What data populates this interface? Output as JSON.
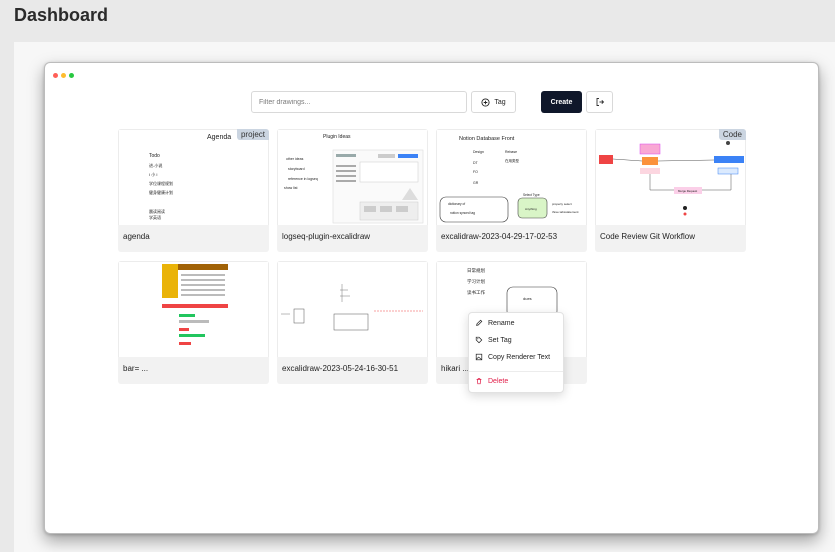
{
  "page": {
    "title": "Dashboard"
  },
  "toolbar": {
    "filter_placeholder": "Filter drawings...",
    "tag_label": "Tag",
    "create_label": "Create"
  },
  "colors": {
    "accent_dark": "#0f172a",
    "badge_bg": "#cbd5e1",
    "delete_red": "#e11d48"
  },
  "cards": [
    {
      "name": "agenda",
      "badge": "project",
      "thumb_text": [
        "Agenda",
        "Todo",
        "进-小说",
        "I 小 I",
        "学位课程规划",
        "健身健康计划",
        "晨读阅读",
        "学英语"
      ]
    },
    {
      "name": "logseq-plugin-excalidraw",
      "badge": "",
      "thumb_text": [
        "Plugin Ideas",
        "other ideas",
        "storyboard",
        "reference in logseq",
        "show list"
      ]
    },
    {
      "name": "excalidraw-2023-04-29-17-02-53",
      "badge": "",
      "thumb_text": [
        "Notion Database Front",
        "Design",
        "Rebase",
        "DT",
        "在用类型",
        "FO",
        "GR",
        "dictionary of",
        "notion synced tag",
        "Select Type",
        "Anything",
        "property select",
        "three tabsstatement"
      ]
    },
    {
      "name": "Code Review Git Workflow",
      "badge": "Code",
      "thumb_text": [
        "Merge Request"
      ]
    },
    {
      "name": "bar= ...",
      "badge": "",
      "thumb_text": []
    },
    {
      "name": "excalidraw-2023-05-24-16-30-51",
      "badge": "",
      "thumb_text": []
    },
    {
      "name": "hikari ...",
      "badge": "",
      "thumb_text": [
        "日常规划",
        "学习计划",
        "读书工作",
        "dues"
      ]
    }
  ],
  "context_menu": {
    "rename": "Rename",
    "set_tag": "Set Tag",
    "copy_renderer_text": "Copy Renderer Text",
    "delete": "Delete"
  }
}
